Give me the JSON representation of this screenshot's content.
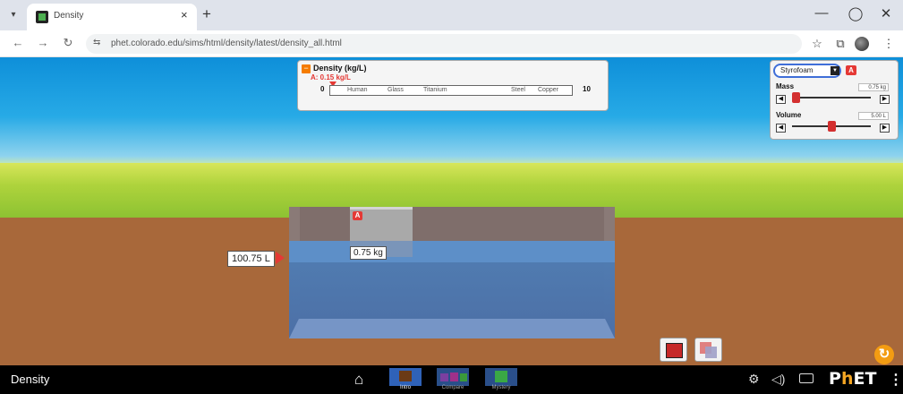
{
  "browser": {
    "tab_title": "Density",
    "tab_close": "×",
    "tab_menu": "▾",
    "new_tab": "+",
    "minimize": "—",
    "restore": "◯",
    "close": "✕",
    "back": "←",
    "forward": "→",
    "reload": "↻",
    "url_icon": "⇆",
    "url": "phet.colorado.edu/sims/html/density/latest/density_all.html",
    "star": "☆",
    "extensions": "⧉",
    "menu": "⋮"
  },
  "density_panel": {
    "collapse_icon": "−",
    "title": "Density (kg/L)",
    "marker_label": "A: 0.15 kg/L",
    "min": "0",
    "max": "10",
    "materials": [
      "Human",
      "Glass",
      "Titanium",
      "Steel",
      "Copper"
    ],
    "marker_value": 0.15
  },
  "material_panel": {
    "selected": "Styrofoam",
    "dropdown_arrow": "▼",
    "tag": "A",
    "mass_label": "Mass",
    "mass_value": "0.75 kg",
    "volume_label": "Volume",
    "volume_value": "5.00 L",
    "dec": "◀",
    "inc": "▶",
    "mass_fraction": 0.05,
    "volume_fraction": 0.5
  },
  "scene": {
    "block_tag": "A",
    "block_mass": "0.75 kg",
    "pool_volume": "100.75 L",
    "reset": "↻"
  },
  "navbar": {
    "sim_title": "Density",
    "home": "⌂",
    "screens": [
      "Intro",
      "Compare",
      "Mystery"
    ],
    "gear": "⚙",
    "sound": "◁)",
    "logo_p": "P",
    "logo_h": "h",
    "logo_et": "ET",
    "menu": "⋮"
  }
}
